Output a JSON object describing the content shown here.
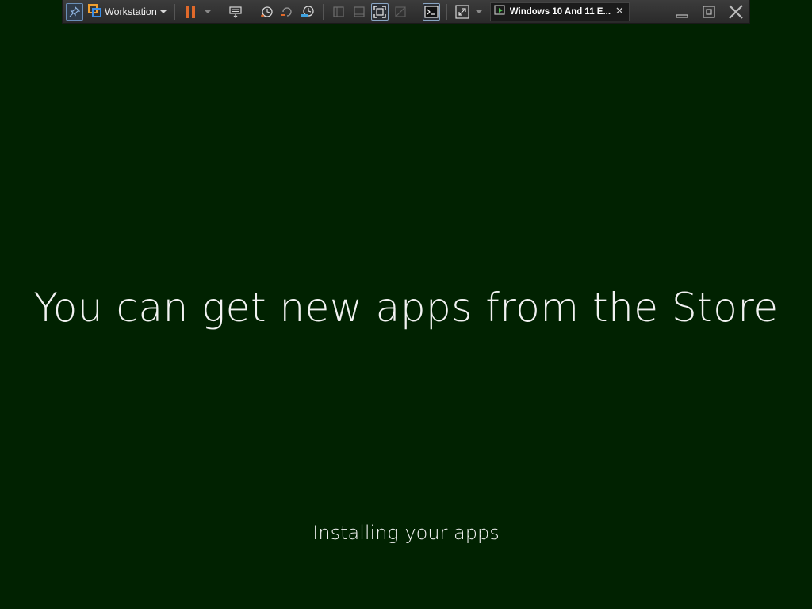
{
  "toolbar": {
    "product_label": "Workstation",
    "vm_tab_label": "Windows 10 And 11 E...",
    "tab_close_glyph": "✕",
    "icons": [
      "pin-icon",
      "vmware-logo-icon",
      "dropdown-arrow-icon",
      "pause-icon",
      "power-dropdown-arrow-icon",
      "send-ctrl-alt-del-icon",
      "snapshot-take-icon",
      "snapshot-revert-icon",
      "snapshot-manager-icon",
      "library-view-icon",
      "thumbnail-bar-icon",
      "fit-guest-icon",
      "unity-icon",
      "console-view-icon",
      "stretch-guest-icon",
      "fullscreen-dropdown-arrow-icon",
      "vm-running-icon",
      "minimize-icon",
      "restore-icon",
      "close-window-icon"
    ],
    "accent_colors": {
      "pause": "#e0692a",
      "vmware_blue": "#3a8ee6",
      "vmware_orange": "#f0a030",
      "snapshot_blue": "#3fa3e0",
      "vm_running_green": "#4fc24f"
    }
  },
  "guest": {
    "background_color": "#012201",
    "headline": "You can get new apps from the Store",
    "status": "Installing your apps"
  }
}
